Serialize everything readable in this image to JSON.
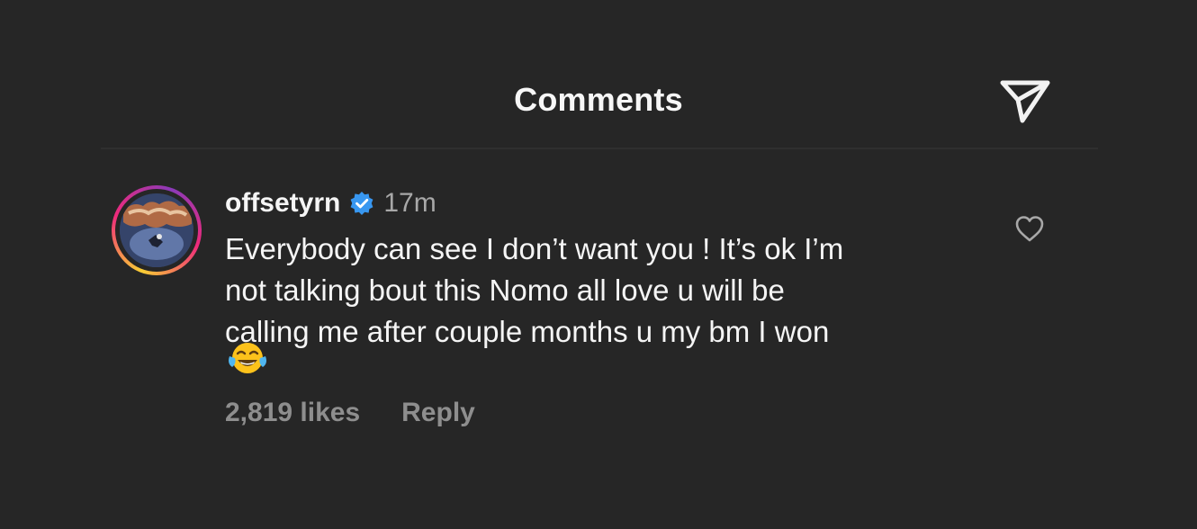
{
  "header": {
    "title": "Comments",
    "share_icon": "send-icon"
  },
  "comment": {
    "username": "offsetyrn",
    "verified_icon": "verified-badge-icon",
    "timestamp": "17m",
    "text": "Everybody can see I don’t want you ! It’s ok I’m\nnot talking bout this Nomo all love u will be\ncalling me after couple months u my bm I won",
    "emoji_icon": "face-with-tears-of-joy-icon",
    "likes": "2,819 likes",
    "reply_label": "Reply",
    "like_icon": "heart-outline-icon"
  },
  "colors": {
    "background": "#262626",
    "text_primary": "#f5f5f5",
    "text_secondary": "#8e8e8e",
    "verified_blue": "#3897f0",
    "story_ring_start": "#f9ce34",
    "story_ring_mid": "#ee2a7b",
    "story_ring_end": "#8a3ab9"
  }
}
